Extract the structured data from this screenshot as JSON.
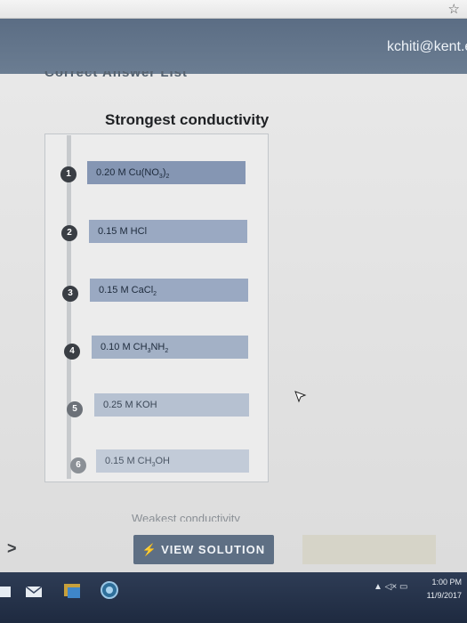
{
  "browser": {
    "star_icon": "star-icon"
  },
  "header": {
    "user_email": "kchiti@kent.e"
  },
  "question": {
    "answer_list_title": "Correct Answer List",
    "top_label": "Strongest conductivity",
    "bottom_label": "Weakest conductivity",
    "items": [
      {
        "number": "1",
        "prefix": "0.20 M Cu(NO",
        "sub1": "3",
        "mid": ")",
        "sub2": "2",
        "suffix": ""
      },
      {
        "number": "2",
        "prefix": "0.15 M HCl",
        "sub1": "",
        "mid": "",
        "sub2": "",
        "suffix": ""
      },
      {
        "number": "3",
        "prefix": "0.15 M CaCl",
        "sub1": "2",
        "mid": "",
        "sub2": "",
        "suffix": ""
      },
      {
        "number": "4",
        "prefix": "0.10 M CH",
        "sub1": "3",
        "mid": "NH",
        "sub2": "2",
        "suffix": ""
      },
      {
        "number": "5",
        "prefix": "0.25 M KOH",
        "sub1": "",
        "mid": "",
        "sub2": "",
        "suffix": ""
      },
      {
        "number": "6",
        "prefix": "0.15 M CH",
        "sub1": "3",
        "mid": "OH",
        "sub2": "",
        "suffix": ""
      }
    ],
    "view_solution_label": "VIEW SOLUTION"
  },
  "taskbar": {
    "time": "1:00 PM",
    "date": "11/9/2017"
  },
  "colors": {
    "header": "#5b6d84",
    "item_bar": "#9aa9c2",
    "button": "#5e6f84"
  }
}
